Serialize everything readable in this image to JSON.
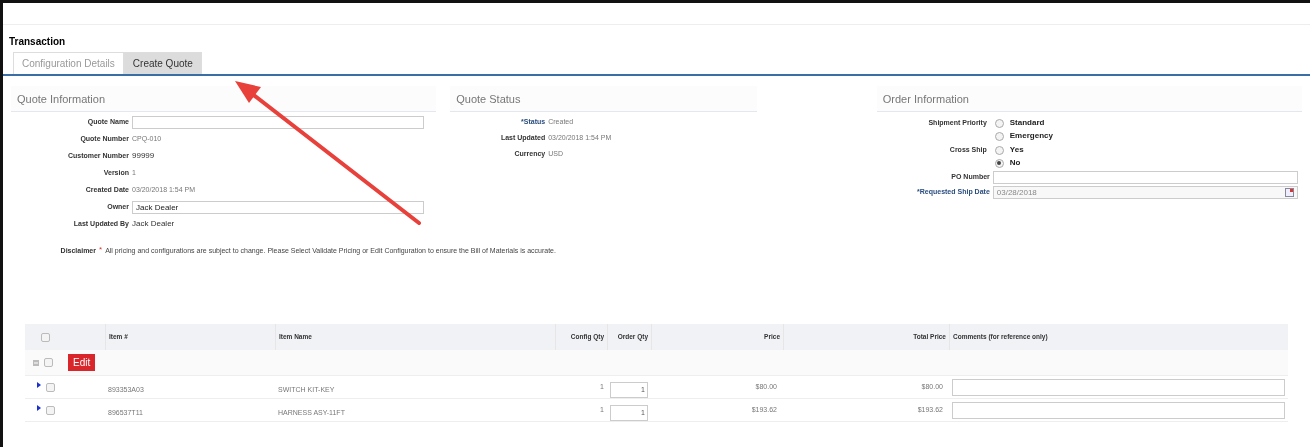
{
  "page_title": "Transaction",
  "tabs": [
    {
      "label": "Configuration Details",
      "selected": false
    },
    {
      "label": "Create Quote",
      "selected": true
    }
  ],
  "quote_information": {
    "title": "Quote Information",
    "fields": [
      {
        "label": "Quote Name",
        "kind": "input"
      },
      {
        "label": "Quote Number",
        "kind": "text",
        "value": "CPQ-010"
      },
      {
        "label": "Customer Number",
        "kind": "strong",
        "value": "99999"
      },
      {
        "label": "Version",
        "kind": "text",
        "value": "1"
      },
      {
        "label": "Created Date",
        "kind": "text",
        "value": "03/20/2018 1:54 PM"
      },
      {
        "label": "Owner",
        "kind": "input",
        "value": "Jack Dealer"
      },
      {
        "label": "Last Updated By",
        "kind": "strong",
        "value": "Jack Dealer"
      }
    ],
    "disclaimer": {
      "label": "Disclaimer",
      "mark": "*",
      "text": "All pricing and configurations are subject to change. Please Select Validate Pricing or Edit Configuration to ensure the Bill of Materials is accurate."
    }
  },
  "quote_status": {
    "title": "Quote Status",
    "fields": [
      {
        "label": "*Status",
        "required": true,
        "value": "Created"
      },
      {
        "label": "Last Updated",
        "required": false,
        "value": "03/20/2018 1:54 PM"
      },
      {
        "label": "Currency",
        "required": false,
        "value": "USD"
      }
    ]
  },
  "order_information": {
    "title": "Order Information",
    "shipment_priority": {
      "label": "Shipment Priority",
      "options": [
        {
          "label": "Standard",
          "selected": false
        },
        {
          "label": "Emergency",
          "selected": false
        }
      ]
    },
    "cross_ship": {
      "label": "Cross Ship",
      "options": [
        {
          "label": "Yes",
          "selected": false
        },
        {
          "label": "No",
          "selected": true
        }
      ]
    },
    "po_number": {
      "label": "PO Number"
    },
    "requested_ship_date": {
      "label": "*Requested Ship Date",
      "value": "03/28/2018"
    }
  },
  "table": {
    "columns": [
      "Item #",
      "Item Name",
      "Config Qty",
      "Order Qty",
      "Price",
      "Total Price",
      "Comments (for reference only)"
    ],
    "header_checked": false,
    "edit_button": "Edit",
    "edit_row_checked": false,
    "rows": [
      {
        "item": "893353A03",
        "name": "SWITCH KIT-KEY",
        "config_qty": "1",
        "order_qty": "1",
        "price": "$80.00",
        "total": "$80.00",
        "checked": false
      },
      {
        "item": "896537T11",
        "name": "HARNESS ASY-11FT",
        "config_qty": "1",
        "order_qty": "1",
        "price": "$193.62",
        "total": "$193.62",
        "checked": false
      }
    ]
  }
}
